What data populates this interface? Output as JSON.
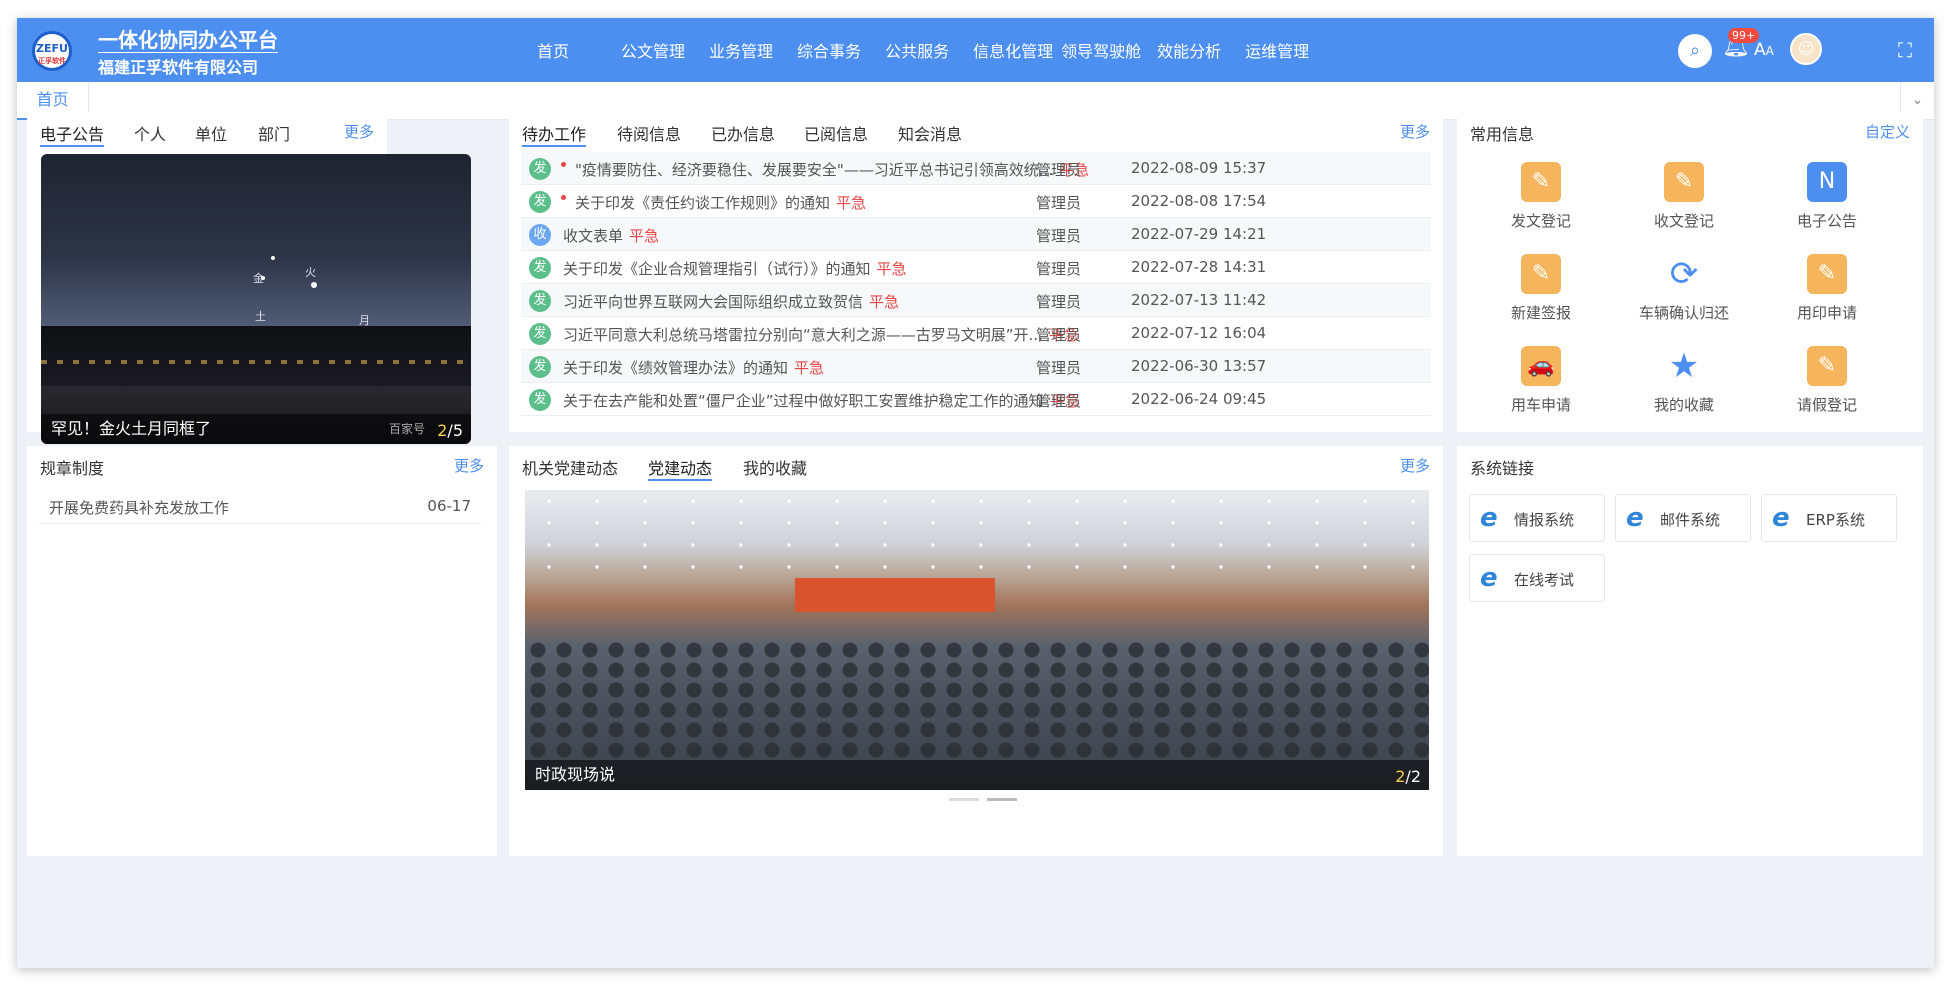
{
  "header": {
    "logo_text": "ZEFU",
    "logo_sub": "正孚软件",
    "title": "一体化协同办公平台",
    "company": "福建正孚软件有限公司",
    "nav": [
      "首页",
      "公文管理",
      "业务管理",
      "综合事务",
      "公共服务",
      "信息化管理",
      "领导驾驶舱",
      "效能分析",
      "运维管理"
    ],
    "notification_badge": "99+",
    "font_icon": "A",
    "font_icon_small": "A"
  },
  "tabs": {
    "active": "首页"
  },
  "announcements": {
    "tabs": [
      "电子公告",
      "个人",
      "单位",
      "部门"
    ],
    "more": "更多",
    "slide_caption": "罕见！金火土月同框了",
    "slide_watermark": "百家号",
    "slide_current": "2",
    "slide_total": "/5",
    "planet_labels": [
      "金",
      "火",
      "土",
      "月"
    ]
  },
  "todo": {
    "tabs": [
      "待办工作",
      "待阅信息",
      "已办信息",
      "已阅信息",
      "知会消息"
    ],
    "more": "更多",
    "urgent_label": "平急",
    "rows": [
      {
        "type": "发",
        "dot": true,
        "title": "\"疫情要防住、经济要稳住、发展要安全\"——习近平总书记引领高效统...",
        "user": "管理员",
        "time": "2022-08-09 15:37"
      },
      {
        "type": "发",
        "dot": true,
        "title": "关于印发《责任约谈工作规则》的通知",
        "user": "管理员",
        "time": "2022-08-08 17:54"
      },
      {
        "type": "收",
        "dot": false,
        "title": "收文表单",
        "user": "管理员",
        "time": "2022-07-29 14:21"
      },
      {
        "type": "发",
        "dot": false,
        "title": "关于印发《企业合规管理指引（试行）》的通知",
        "user": "管理员",
        "time": "2022-07-28 14:31"
      },
      {
        "type": "发",
        "dot": false,
        "title": "习近平向世界互联网大会国际组织成立致贺信",
        "user": "管理员",
        "time": "2022-07-13 11:42"
      },
      {
        "type": "发",
        "dot": false,
        "title": "习近平同意大利总统马塔雷拉分别向“意大利之源——古罗马文明展”开...",
        "user": "管理员",
        "time": "2022-07-12 16:04"
      },
      {
        "type": "发",
        "dot": false,
        "title": "关于印发《绩效管理办法》的通知",
        "user": "管理员",
        "time": "2022-06-30 13:57"
      },
      {
        "type": "发",
        "dot": false,
        "title": "关于在去产能和处置“僵尸企业”过程中做好职工安置维护稳定工作的通知",
        "user": "管理员",
        "time": "2022-06-24 09:45"
      }
    ]
  },
  "common": {
    "title": "常用信息",
    "customize": "自定义",
    "items": [
      {
        "label": "发文登记",
        "icon": "edit-doc-icon",
        "glyph": "✎",
        "style": "orange"
      },
      {
        "label": "收文登记",
        "icon": "edit-doc-icon",
        "glyph": "✎",
        "style": "orange"
      },
      {
        "label": "电子公告",
        "icon": "notice-n-icon",
        "glyph": "N",
        "style": "blue"
      },
      {
        "label": "新建签报",
        "icon": "edit-doc-icon",
        "glyph": "✎",
        "style": "orange"
      },
      {
        "label": "车辆确认归还",
        "icon": "refresh-icon",
        "glyph": "⟳",
        "style": "blank"
      },
      {
        "label": "用印申请",
        "icon": "edit-doc-icon",
        "glyph": "✎",
        "style": "orange"
      },
      {
        "label": "用车申请",
        "icon": "car-icon",
        "glyph": "🚗",
        "style": "orange"
      },
      {
        "label": "我的收藏",
        "icon": "star-icon",
        "glyph": "★",
        "style": "blank"
      },
      {
        "label": "请假登记",
        "icon": "edit-doc-icon",
        "glyph": "✎",
        "style": "orange"
      }
    ]
  },
  "rules": {
    "title": "规章制度",
    "more": "更多",
    "items": [
      {
        "title": "开展免费药具补充发放工作",
        "date": "06-17"
      }
    ]
  },
  "party": {
    "tabs": [
      "机关党建动态",
      "党建动态",
      "我的收藏"
    ],
    "more": "更多",
    "slide_caption": "时政现场说",
    "slide_current": "2",
    "slide_total": "/2"
  },
  "links": {
    "title": "系统链接",
    "items": [
      "情报系统",
      "邮件系统",
      "ERP系统",
      "在线考试"
    ]
  },
  "colors": {
    "primary": "#4d8ff0",
    "urgent": "#e64545",
    "fa": "#5cbe8a",
    "shou": "#6aa7f0",
    "quick_orange": "#f5b55c"
  }
}
